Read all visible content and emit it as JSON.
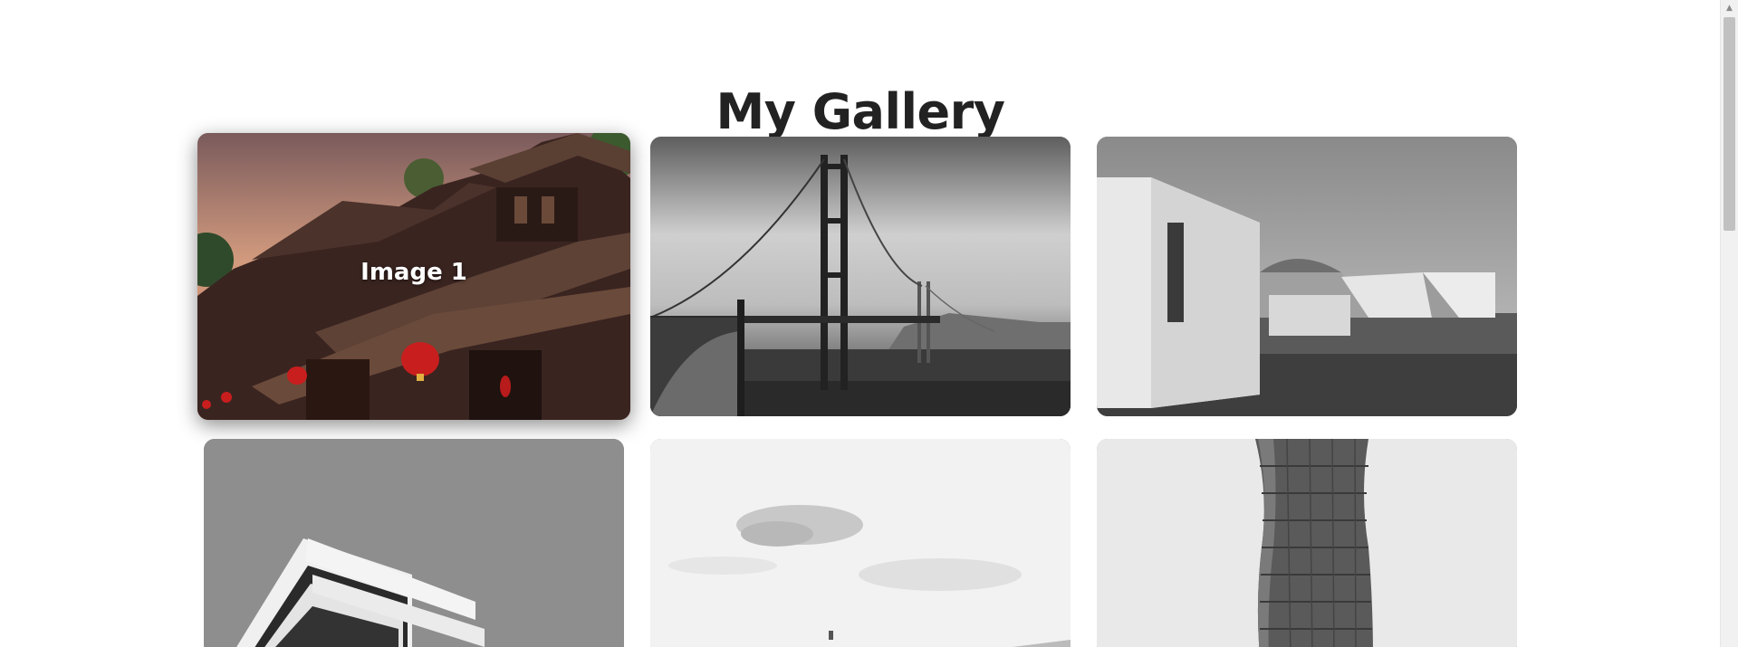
{
  "page": {
    "title": "My Gallery"
  },
  "gallery": {
    "items": [
      {
        "caption": "Image 1",
        "style": "color",
        "hovered": true,
        "icon": "pagoda-photo"
      },
      {
        "caption": "",
        "style": "grayscale",
        "hovered": false,
        "icon": "bridge-photo"
      },
      {
        "caption": "",
        "style": "grayscale",
        "hovered": false,
        "icon": "museum-photo"
      },
      {
        "caption": "",
        "style": "grayscale",
        "hovered": false,
        "icon": "building-photo"
      },
      {
        "caption": "",
        "style": "grayscale",
        "hovered": false,
        "icon": "sky-photo"
      },
      {
        "caption": "",
        "style": "grayscale",
        "hovered": false,
        "icon": "tower-photo"
      }
    ]
  },
  "scrollbar": {
    "up_arrow": "▲"
  },
  "colors": {
    "title": "#222222",
    "background": "#ffffff",
    "caption": "#ffffff"
  }
}
